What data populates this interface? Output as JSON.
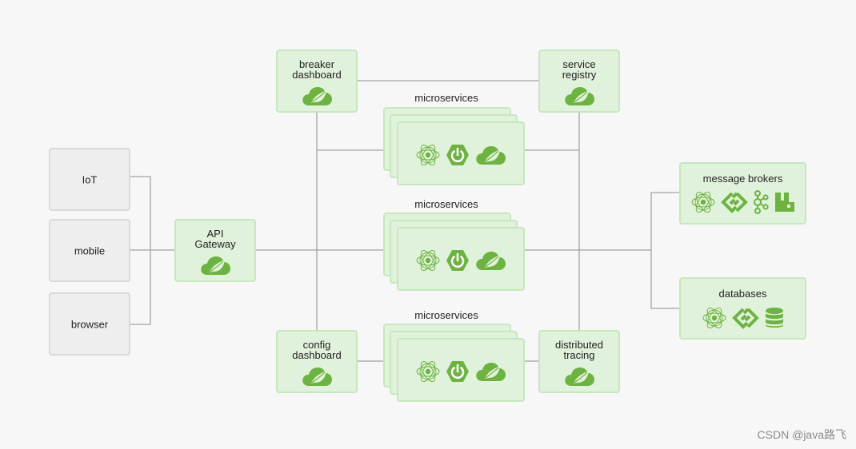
{
  "colors": {
    "background": "#f7f7f7",
    "spring_green": "#6db33f",
    "box_green_fill": "#e1f2dc",
    "box_green_border": "#c6e8bd",
    "client_fill": "#eeeeee",
    "line": "#a0a0a0"
  },
  "clients": [
    {
      "label": "IoT"
    },
    {
      "label": "mobile"
    },
    {
      "label": "browser"
    }
  ],
  "gateway": {
    "label_line1": "API",
    "label_line2": "Gateway",
    "icon": "spring-cloud-icon"
  },
  "breaker_dashboard": {
    "label_line1": "breaker",
    "label_line2": "dashboard",
    "icon": "spring-cloud-icon"
  },
  "service_registry": {
    "label_line1": "service",
    "label_line2": "registry",
    "icon": "spring-cloud-icon"
  },
  "config_dashboard": {
    "label_line1": "config",
    "label_line2": "dashboard",
    "icon": "spring-cloud-icon"
  },
  "distributed_tracing": {
    "label_line1": "distributed",
    "label_line2": "tracing",
    "icon": "spring-cloud-icon"
  },
  "microservices": [
    {
      "label": "microservices",
      "icons": [
        "atom-icon",
        "spring-boot-power-icon",
        "spring-cloud-icon"
      ]
    },
    {
      "label": "microservices",
      "icons": [
        "atom-icon",
        "spring-boot-power-icon",
        "spring-cloud-icon"
      ]
    },
    {
      "label": "microservices",
      "icons": [
        "atom-icon",
        "spring-boot-power-icon",
        "spring-cloud-icon"
      ]
    }
  ],
  "message_brokers": {
    "label": "message brokers",
    "icons": [
      "atom-icon",
      "spring-integration-icon",
      "kafka-icon",
      "rabbitmq-icon"
    ]
  },
  "databases": {
    "label": "databases",
    "icons": [
      "atom-icon",
      "spring-integration-icon",
      "database-icon"
    ]
  },
  "watermark": "CSDN @java路飞"
}
